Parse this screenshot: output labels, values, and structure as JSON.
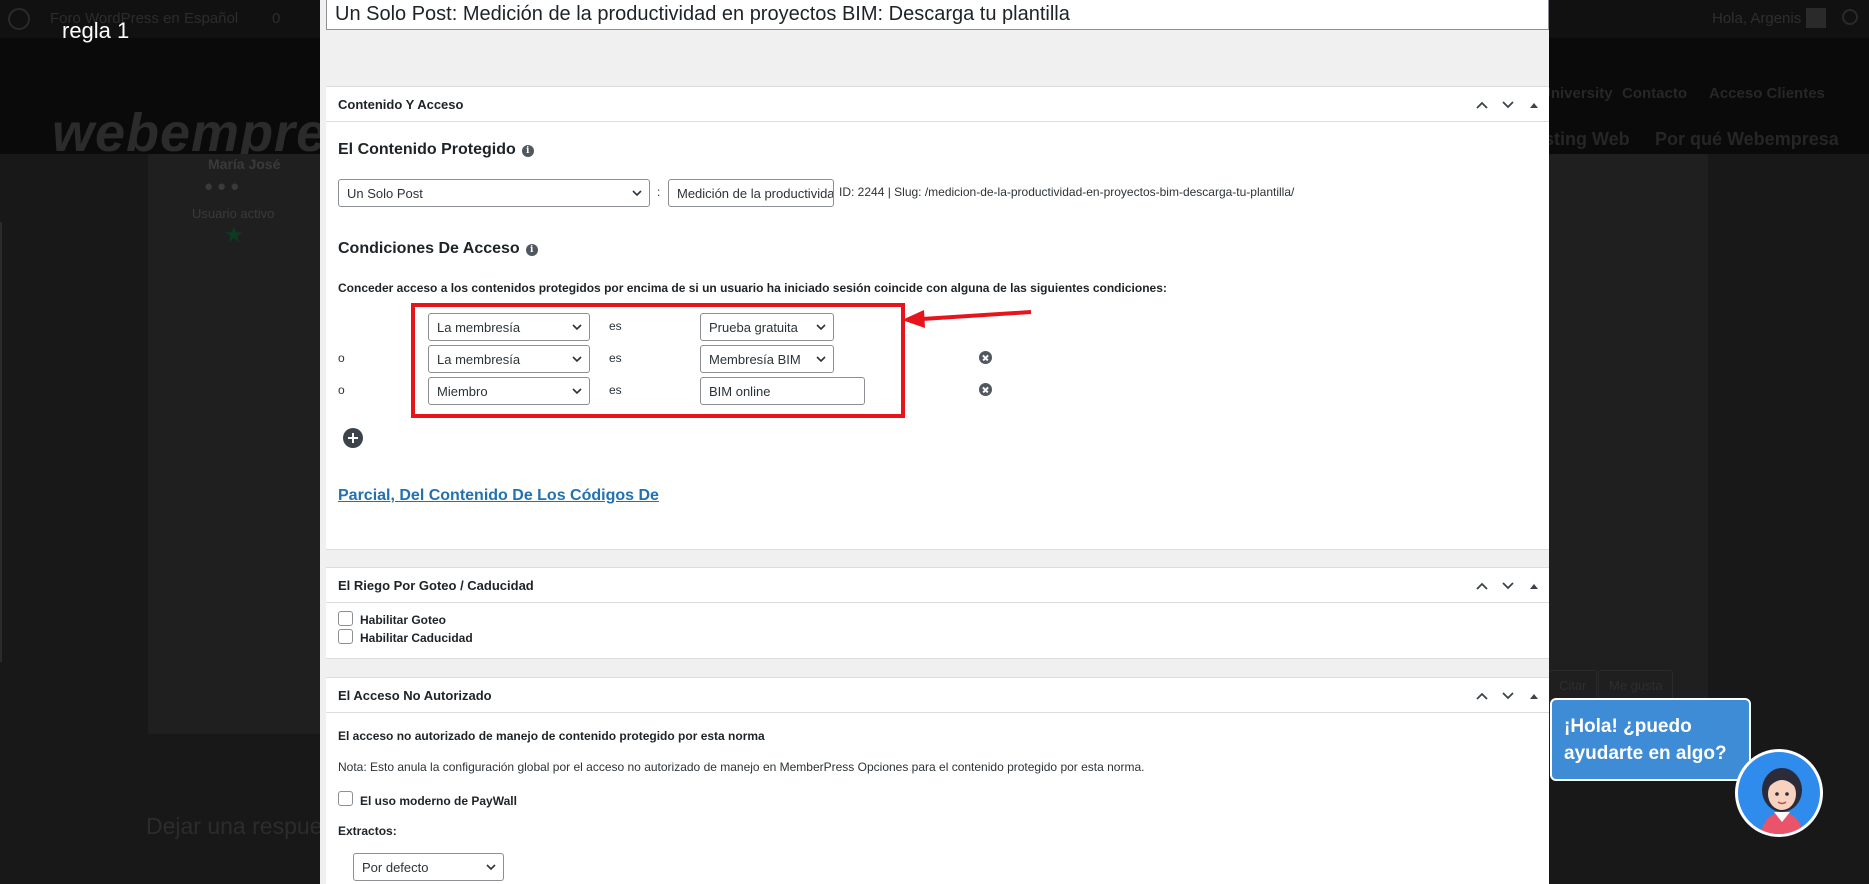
{
  "background": {
    "admin_bar": {
      "site_name": "Foro WordPress en Español",
      "comments_count": "0",
      "greeting": "Hola, Argenis"
    },
    "header": {
      "logo_text": "webempresa",
      "top_nav": [
        "University",
        "Contacto",
        "Acceso Clientes"
      ],
      "main_nav": [
        "Hosting Web",
        "Por qué Webempresa"
      ]
    },
    "author": {
      "name": "María José",
      "status": "Usuario activo"
    },
    "actions": [
      "Citar",
      "Me gusta"
    ],
    "reply_heading": "Dejar una respuesta"
  },
  "rule_title": "regla 1",
  "modal": {
    "post_title": "Un Solo Post: Medición de la productividad en proyectos BIM: Descarga tu plantilla",
    "content_access_panel": {
      "title": "Contenido Y Acceso",
      "protected_heading": "El Contenido Protegido",
      "content_type": "Un Solo Post",
      "separator": ":",
      "post_search_value": "Medición de la productividad en proyectos BIM",
      "post_meta": "ID: 2244 | Slug: /medicion-de-la-productividad-en-proyectos-bim-descarga-tu-plantilla/",
      "conditions_heading": "Condiciones De Acceso",
      "conditions_desc": "Conceder acceso a los contenidos protegidos por encima de si un usuario ha iniciado sesión coincide con alguna de las siguientes condiciones:",
      "conditions": [
        {
          "connector": "",
          "type": "La membresía",
          "operator": "es",
          "value": "Prueba gratuita"
        },
        {
          "connector": "o",
          "type": "La membresía",
          "operator": "es",
          "value": "Membresía BIM"
        },
        {
          "connector": "o",
          "type": "Miembro",
          "operator": "es",
          "value": "BIM online"
        }
      ],
      "partial_link": "Parcial, Del Contenido De Los Códigos De"
    },
    "drip_panel": {
      "title": "El Riego Por Goteo / Caducidad",
      "enable_drip": "Habilitar Goteo",
      "enable_expiration": "Habilitar Caducidad"
    },
    "unauthorized_panel": {
      "title": "El Acceso No Autorizado",
      "heading": "El acceso no autorizado de manejo de contenido protegido por esta norma",
      "note": "Nota: Esto anula la configuración global por el acceso no autorizado de manejo en MemberPress Opciones para el contenido protegido por esta norma.",
      "paywall_label": "El uso moderno de PayWall",
      "excerpts_label": "Extractos:",
      "excerpts_value": "Por defecto"
    }
  },
  "chat": {
    "message": "¡Hola! ¿puedo ayudarte en algo?"
  },
  "colors": {
    "annotation": "#e8141c",
    "link": "#2271b1",
    "chat": "#3e8bd6"
  }
}
